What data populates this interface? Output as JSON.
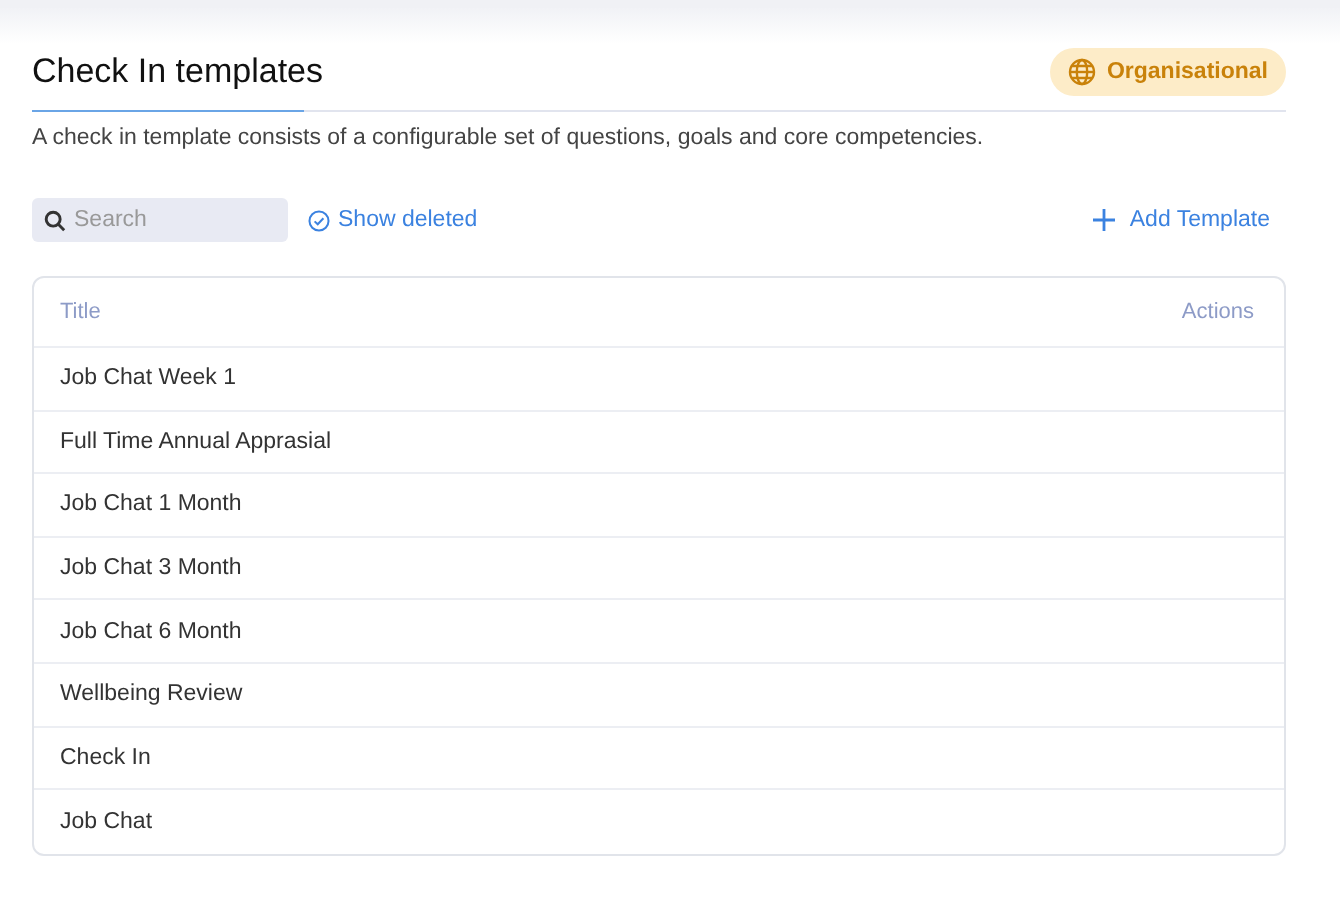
{
  "header": {
    "title": "Check In templates",
    "badge": "Organisational"
  },
  "description": "A check in template consists of a configurable set of questions, goals and core competencies.",
  "toolbar": {
    "search": {
      "placeholder": "Search"
    },
    "show_deleted": "Show deleted",
    "add_button": "Add Template"
  },
  "table": {
    "columns": [
      "Title",
      "Actions"
    ],
    "rows": [
      {
        "title": "Job Chat Week 1"
      },
      {
        "title": "Full Time Annual Apprasial"
      },
      {
        "title": "Job Chat 1 Month"
      },
      {
        "title": "Job Chat 3 Month"
      },
      {
        "title": "Job Chat 6 Month"
      },
      {
        "title": "Wellbeing Review"
      },
      {
        "title": "Check In"
      },
      {
        "title": "Job Chat"
      }
    ]
  }
}
